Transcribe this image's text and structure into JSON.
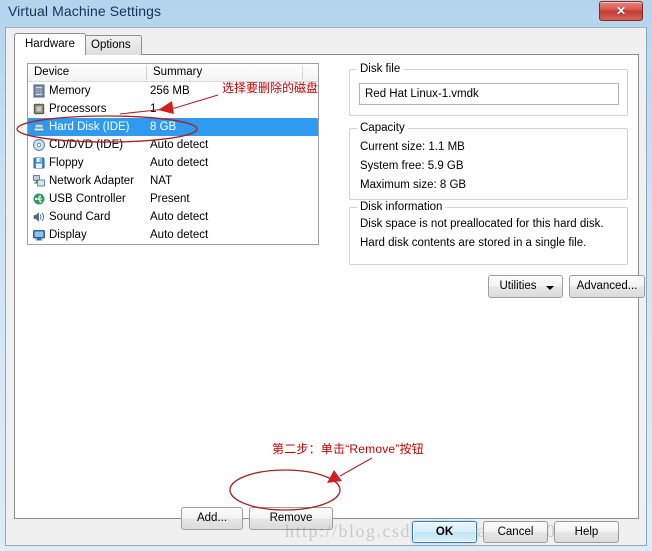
{
  "window": {
    "title": "Virtual Machine Settings",
    "close_label": "✕"
  },
  "tabs": [
    {
      "label": "Hardware",
      "active": true
    },
    {
      "label": "Options",
      "active": false
    }
  ],
  "device_list": {
    "columns": [
      "Device",
      "Summary"
    ],
    "rows": [
      {
        "icon": "memory-icon",
        "name": "Memory",
        "summary": "256 MB",
        "selected": false
      },
      {
        "icon": "processor-icon",
        "name": "Processors",
        "summary": "1",
        "selected": false
      },
      {
        "icon": "hard-disk-icon",
        "name": "Hard Disk (IDE)",
        "summary": "8 GB",
        "selected": true
      },
      {
        "icon": "cd-dvd-icon",
        "name": "CD/DVD (IDE)",
        "summary": "Auto detect",
        "selected": false
      },
      {
        "icon": "floppy-icon",
        "name": "Floppy",
        "summary": "Auto detect",
        "selected": false
      },
      {
        "icon": "network-adapter-icon",
        "name": "Network Adapter",
        "summary": "NAT",
        "selected": false
      },
      {
        "icon": "usb-controller-icon",
        "name": "USB Controller",
        "summary": "Present",
        "selected": false
      },
      {
        "icon": "sound-card-icon",
        "name": "Sound Card",
        "summary": "Auto detect",
        "selected": false
      },
      {
        "icon": "display-icon",
        "name": "Display",
        "summary": "Auto detect",
        "selected": false
      }
    ]
  },
  "disk_file": {
    "group_title": "Disk file",
    "value": "Red Hat Linux-1.vmdk",
    "placeholder": ""
  },
  "capacity": {
    "group_title": "Capacity",
    "lines": [
      "Current size: 1.1 MB",
      "System free: 5.9 GB",
      "Maximum size: 8 GB"
    ]
  },
  "disk_information": {
    "group_title": "Disk information",
    "lines": [
      "Disk space is not preallocated for this hard disk.",
      "Hard disk contents are stored in a single file."
    ]
  },
  "buttons": {
    "utilities": "Utilities",
    "advanced": "Advanced...",
    "add": "Add...",
    "remove": "Remove",
    "ok": "OK",
    "cancel": "Cancel",
    "help": "Help"
  },
  "annotations": {
    "top": "选择要删除的磁盘",
    "bottom": "第二步：单击“Remove”按钮",
    "color": "#cc0000"
  },
  "watermark": {
    "text": "http://blog.csdn.net/lyanqing2013"
  },
  "colors": {
    "selection": "#2e9bf0",
    "dialog_bg": "#f0f0f0",
    "panel_bg": "#ffffff",
    "annotation_red": "#cc0000",
    "close_red": "#c03a30"
  }
}
